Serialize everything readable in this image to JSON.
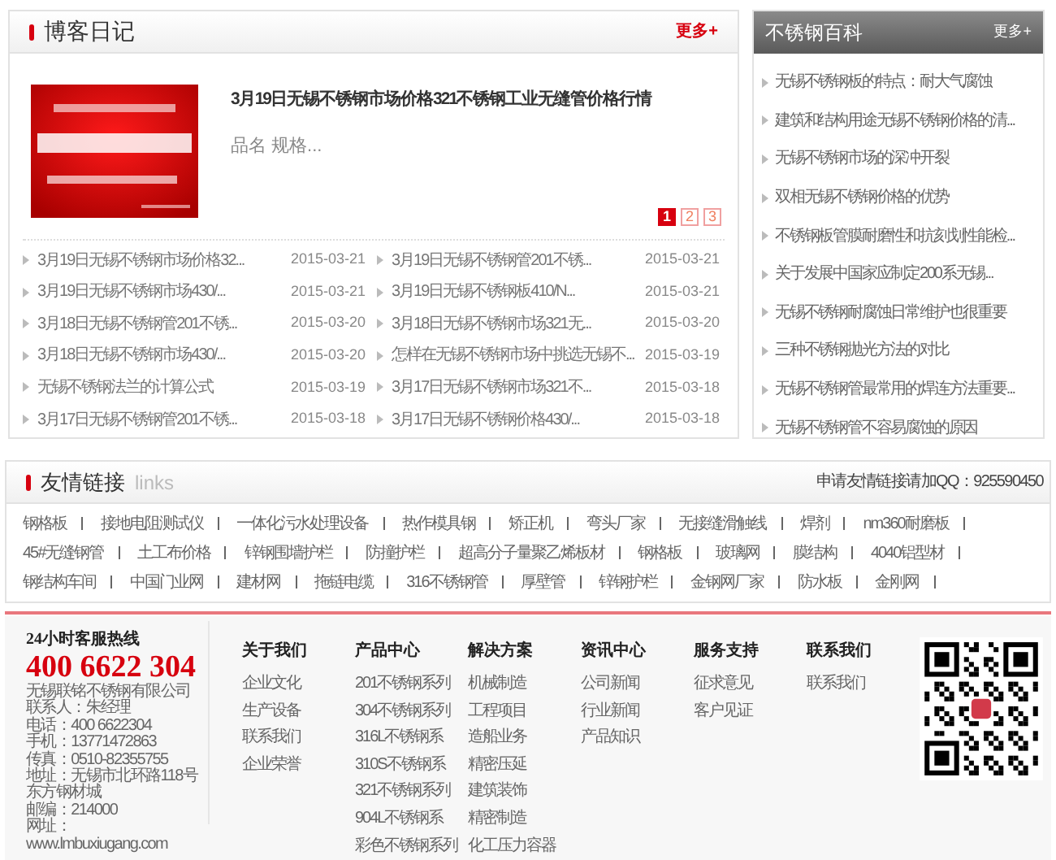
{
  "blog": {
    "title": "博客日记",
    "more": "更多+",
    "featured": {
      "title": "3月19日无锡不锈钢市场价格321不锈钢工业无缝管价格行情",
      "excerpt": "品名 规格..."
    },
    "pages": [
      {
        "label": "1",
        "selected": true
      },
      {
        "label": "2",
        "selected": false
      },
      {
        "label": "3",
        "selected": false
      }
    ],
    "posts": [
      {
        "title": "3月19日无锡不锈钢市场价格32...",
        "date": "2015-03-21"
      },
      {
        "title": "3月19日无锡不锈钢管201不锈...",
        "date": "2015-03-21"
      },
      {
        "title": "3月19日无锡不锈钢市场430/...",
        "date": "2015-03-21"
      },
      {
        "title": "3月19日无锡不锈钢板410/N...",
        "date": "2015-03-21"
      },
      {
        "title": "3月18日无锡不锈钢管201不锈...",
        "date": "2015-03-20"
      },
      {
        "title": "3月18日无锡不锈钢市场321无...",
        "date": "2015-03-20"
      },
      {
        "title": "3月18日无锡不锈钢市场430/...",
        "date": "2015-03-20"
      },
      {
        "title": "怎样在无锡不锈钢市场中挑选无锡不...",
        "date": "2015-03-19"
      },
      {
        "title": "无锡不锈钢法兰的计算公式",
        "date": "2015-03-19"
      },
      {
        "title": "3月17日无锡不锈钢市场321不...",
        "date": "2015-03-18"
      },
      {
        "title": "3月17日无锡不锈钢管201不锈...",
        "date": "2015-03-18"
      },
      {
        "title": "3月17日无锡不锈钢价格430/...",
        "date": "2015-03-18"
      }
    ]
  },
  "encyclopedia": {
    "title": "不锈钢百科",
    "more": "更多+",
    "items": [
      "无锡不锈钢板的特点：耐大气腐蚀",
      "建筑和结构用途无锡不锈钢价格的清...",
      "无锡不锈钢市场的深冲开裂",
      "双相无锡不锈钢价格的优势",
      "不锈钢板管膜耐磨性和抗刻划性能检...",
      "关于发展中国家应制定200系无锡...",
      "无锡不锈钢耐腐蚀日常维护也很重要",
      "三种不锈钢抛光方法的对比",
      "无锡不锈钢管最常用的焊连方法重要...",
      "无锡不锈钢管不容易腐蚀的原因"
    ]
  },
  "links": {
    "title": "友情链接",
    "subtitle": "links",
    "apply_note": "申请友情链接请加QQ：925590450",
    "items": [
      "钢格板",
      "接地电阻测试仪",
      "一体化污水处理设备",
      "热作模具钢",
      "矫正机",
      "弯头厂家",
      "无接缝滑触线",
      "焊剂",
      "nm360耐磨板",
      "45#无缝钢管",
      "土工布价格",
      "锌钢围墙护栏",
      "防撞护栏",
      "超高分子量聚乙烯板材",
      "钢格板",
      "玻璃网",
      "膜结构",
      "4040铝型材",
      "钢结构车间",
      "中国门业网",
      "建材网",
      "拖链电缆",
      "316不锈钢管",
      "厚壁管",
      "锌钢护栏",
      "金钢网厂家",
      "防水板",
      "金刚网"
    ]
  },
  "footer": {
    "hotline_label": "24小时客服热线",
    "hotline": "400 6622 304",
    "contact_lines": [
      "无锡联铭不锈钢有限公司",
      "联系人：朱经理",
      "电话：400 6622304",
      "手机：13771472863",
      "传真：0510-82355755",
      "地址：无锡市北环路118号",
      "东方钢材城",
      "邮编：214000",
      "网址：",
      "www.lmbuxiugang.com"
    ],
    "columns": [
      {
        "heading": "关于我们",
        "links": [
          "企业文化",
          "生产设备",
          "联系我们",
          "企业荣誉"
        ]
      },
      {
        "heading": "产品中心",
        "links": [
          "201不锈钢系列",
          "304不锈钢系列",
          "316L不锈钢系",
          "310S不锈钢系",
          "321不锈钢系列",
          "904L不锈钢系",
          "彩色不锈钢系列"
        ]
      },
      {
        "heading": "解决方案",
        "links": [
          "机械制造",
          "工程项目",
          "造船业务",
          "精密压延",
          "建筑装饰",
          "精密制造",
          "化工压力容器"
        ]
      },
      {
        "heading": "资讯中心",
        "links": [
          "公司新闻",
          "行业新闻",
          "产品知识"
        ]
      },
      {
        "heading": "服务支持",
        "links": [
          "征求意见",
          "客户见证"
        ]
      },
      {
        "heading": "联系我们",
        "links": [
          "联系我们"
        ]
      }
    ]
  }
}
